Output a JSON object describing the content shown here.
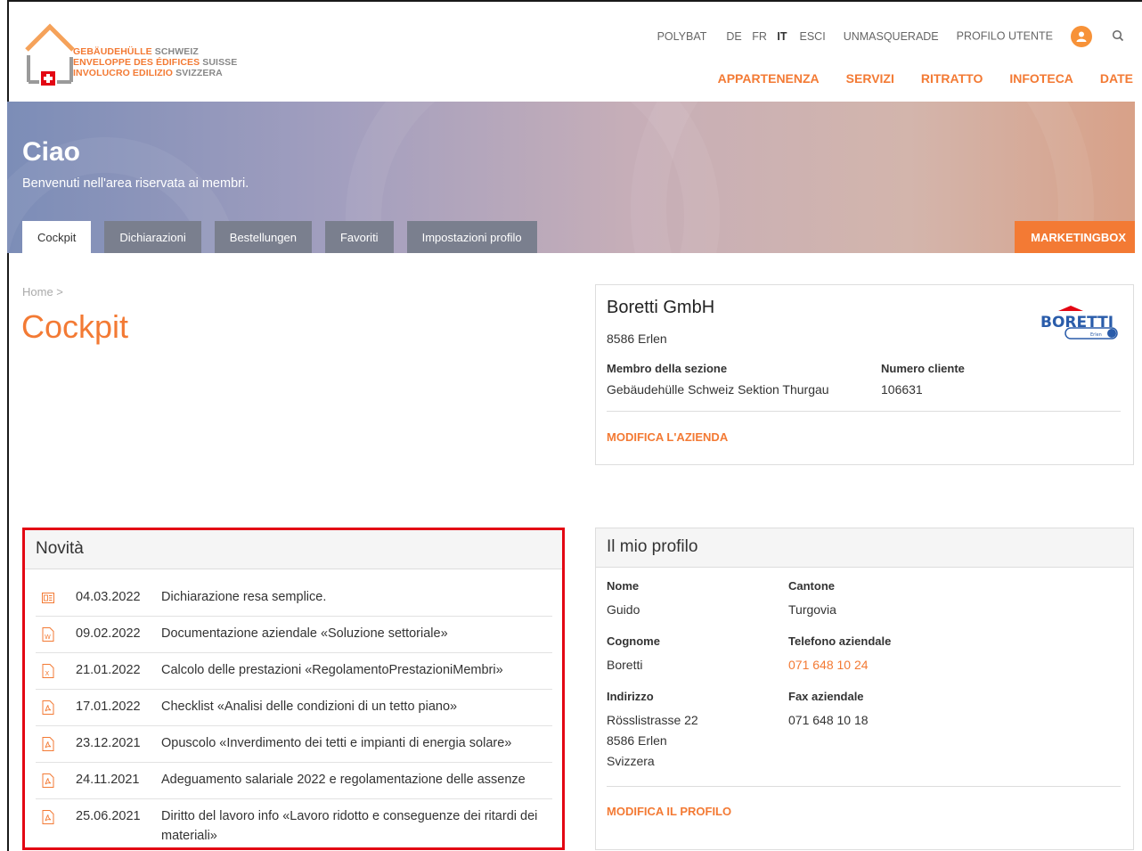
{
  "logo": {
    "line1_a": "GEBÄUDEHÜLLE",
    "line1_b": "SCHWEIZ",
    "line2_a": "ENVELOPPE DES ÉDIFICES",
    "line2_b": "SUISSE",
    "line3_a": "INVOLUCRO EDILIZIO",
    "line3_b": "SVIZZERA"
  },
  "utility_nav": {
    "polybat": "POLYBAT",
    "languages": [
      "DE",
      "FR",
      "IT"
    ],
    "active_language": "IT",
    "logout": "ESCI",
    "unmasquerade": "UNMASQUERADE",
    "profile": "PROFILO UTENTE"
  },
  "main_nav": [
    "APPARTENENZA",
    "SERVIZI",
    "RITRATTO",
    "INFOTECA",
    "DATE"
  ],
  "hero": {
    "title": "Ciao",
    "subtitle": "Benvenuti nell'area riservata ai membri."
  },
  "tabs": [
    "Cockpit",
    "Dichiarazioni",
    "Bestellungen",
    "Favoriti",
    "Impostazioni profilo"
  ],
  "active_tab": "Cockpit",
  "marketingbox": "MARKETINGBOX",
  "breadcrumb": "Home >",
  "page_title": "Cockpit",
  "company": {
    "name": "Boretti GmbH",
    "city": "8586 Erlen",
    "section_label": "Membro della sezione",
    "section_value": "Gebäudehülle Schweiz Sektion Thurgau",
    "customer_label": "Numero cliente",
    "customer_value": "106631",
    "edit_link": "MODIFICA L'AZIENDA",
    "logo_text": "BORETTI",
    "logo_sub": "Erlen"
  },
  "news": {
    "title": "Novità",
    "items": [
      {
        "icon": "document-icon",
        "date": "04.03.2022",
        "title": "Dichiarazione resa semplice."
      },
      {
        "icon": "word-file-icon",
        "date": "09.02.2022",
        "title": "Documentazione aziendale «Soluzione settoriale»"
      },
      {
        "icon": "excel-file-icon",
        "date": "21.01.2022",
        "title": "Calcolo delle prestazioni «RegolamentoPrestazioniMembri»"
      },
      {
        "icon": "pdf-file-icon",
        "date": "17.01.2022",
        "title": "Checklist «Analisi delle condizioni di un tetto piano»"
      },
      {
        "icon": "pdf-file-icon",
        "date": "23.12.2021",
        "title": "Opuscolo «Inverdimento dei tetti e impianti di energia solare»"
      },
      {
        "icon": "pdf-file-icon",
        "date": "24.11.2021",
        "title": "Adeguamento salariale 2022 e regolamentazione delle assenze"
      },
      {
        "icon": "pdf-file-icon",
        "date": "25.06.2021",
        "title": "Diritto del lavoro info «Lavoro ridotto e conseguenze dei ritardi dei materiali»"
      }
    ]
  },
  "profile": {
    "title": "Il mio profilo",
    "first_name_label": "Nome",
    "first_name": "Guido",
    "canton_label": "Cantone",
    "canton": "Turgovia",
    "last_name_label": "Cognome",
    "last_name": "Boretti",
    "phone_label": "Telefono aziendale",
    "phone": "071 648 10 24",
    "address_label": "Indirizzo",
    "address_street": "Rösslistrasse 22",
    "address_city": "8586 Erlen",
    "address_country": "Svizzera",
    "fax_label": "Fax aziendale",
    "fax": "071 648 10 18",
    "edit_link": "MODIFICA IL PROFILO"
  },
  "colors": {
    "accent": "#f37a34",
    "highlight_border": "#e30613",
    "tab_bg": "#7a7f8e"
  }
}
